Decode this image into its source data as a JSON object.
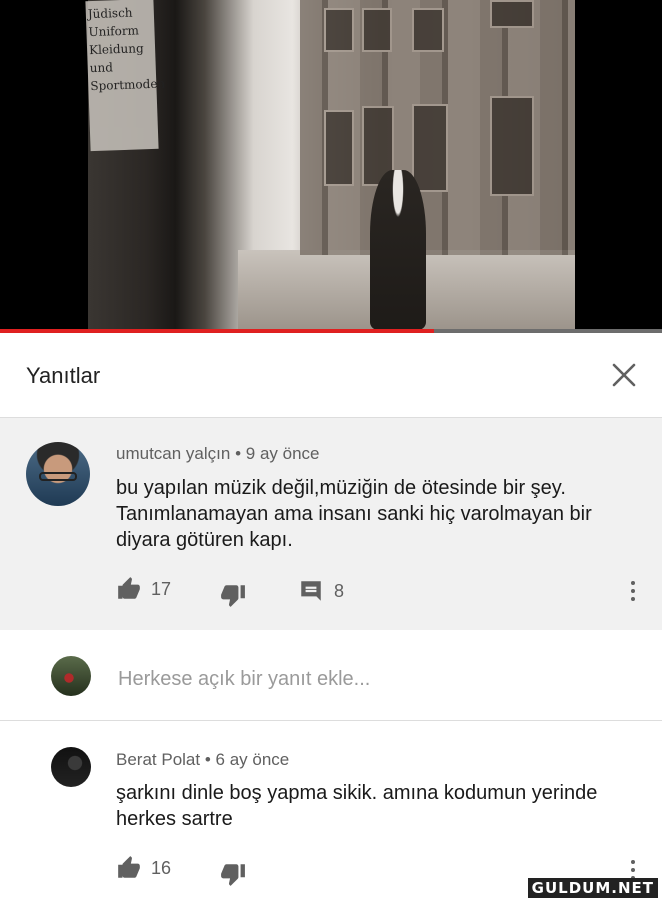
{
  "video": {
    "progress": 0.655,
    "sign_text": "Jüdisch Uniform Kleidung und Sportmoden"
  },
  "header": {
    "title": "Yanıtlar",
    "close_icon": "close-icon"
  },
  "main_comment": {
    "author": "umutcan yalçın",
    "time": "9 ay önce",
    "text": "bu yapılan müzik değil,müziğin de ötesinde bir şey. Tanımlanamayan ama insanı sanki hiç varolmayan bir diyara götüren kapı.",
    "likes": "17",
    "replies": "8"
  },
  "reply_box": {
    "placeholder": "Herkese açık bir yanıt ekle..."
  },
  "reply": {
    "author": "Berat Polat",
    "time": "6 ay önce",
    "text": "şarkını dinle boş yapma sikik. amına kodumun yerinde herkes sartre",
    "likes": "16"
  },
  "watermark": "GULDUM.NET",
  "colors": {
    "accent": "#e02020",
    "comment_bg": "#f1f1f1",
    "meta": "#606060"
  }
}
